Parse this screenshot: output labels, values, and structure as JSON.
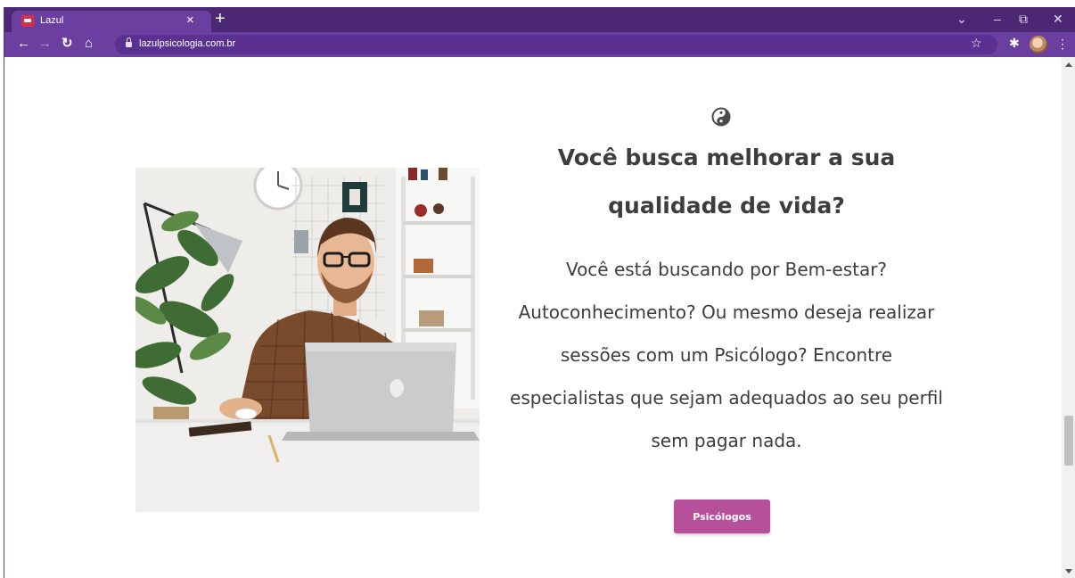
{
  "browser": {
    "tab_title": "Lazul",
    "tab_close": "×",
    "new_tab": "+",
    "url": "lazulpsicologia.com.br",
    "accent_color": "#6b3fa0",
    "frame_color": "#4c2773"
  },
  "page": {
    "icon": "yin-yang-icon",
    "headline": "Você busca melhorar a sua qualidade de vida?",
    "body": "Você está buscando por Bem-estar? Autoconhecimento? Ou mesmo deseja realizar sessões com um Psicólogo? Encontre especialistas que sejam adequados ao seu perfil sem pagar nada.",
    "button_label": "Psicólogos",
    "button_color": "#b7509b",
    "photo": "man-working-at-laptop-photo"
  }
}
